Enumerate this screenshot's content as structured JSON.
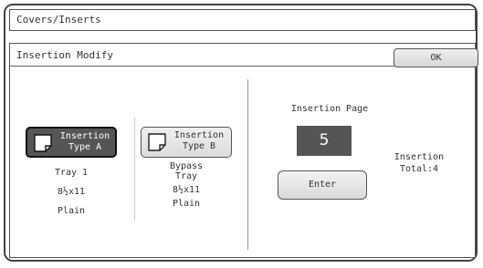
{
  "window": {
    "title": "Covers/Inserts"
  },
  "panel": {
    "title": "Insertion Modify",
    "ok_label": "OK"
  },
  "type_a": {
    "line1": "Insertion",
    "line2": "Type A",
    "tray": "Tray 1",
    "size": "8½x11",
    "paper": "Plain",
    "selected": true
  },
  "type_b": {
    "line1": "Insertion",
    "line2": "Type B",
    "tray_line1": "Bypass",
    "tray_line2": "Tray",
    "size": "8½x11",
    "paper": "Plain",
    "selected": false
  },
  "insertion_page": {
    "label": "Insertion Page",
    "value": "5",
    "enter_label": "Enter"
  },
  "total": {
    "line1": "Insertion",
    "line2": "Total:4"
  },
  "icons": {
    "type_a": "page-icon",
    "type_b": "page-icon"
  }
}
